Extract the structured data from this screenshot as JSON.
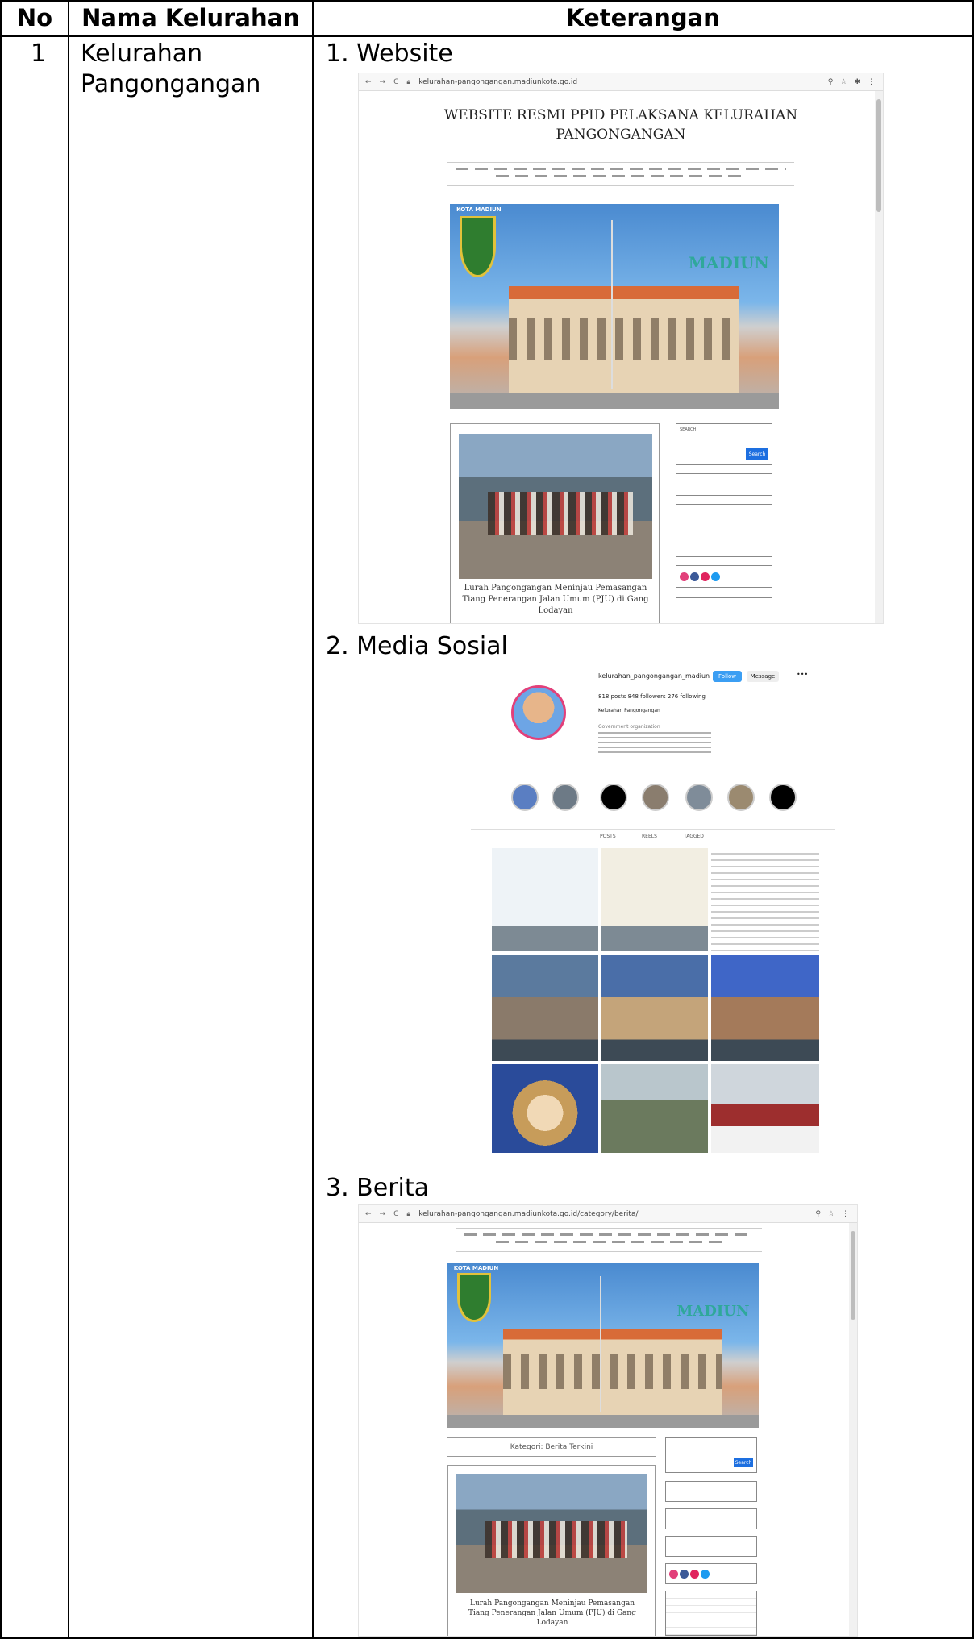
{
  "table": {
    "headers": [
      "No",
      "Nama Kelurahan",
      "Keterangan"
    ],
    "row": {
      "no": "1",
      "name_line1": "Kelurahan",
      "name_line2": "Pangongangan"
    }
  },
  "items": [
    {
      "label": "1. Website"
    },
    {
      "label": "2. Media Sosial"
    },
    {
      "label": "3. Berita"
    }
  ],
  "website_shot": {
    "url": "kelurahan-pangongangan.madiunkota.go.id",
    "title_line1": "WEBSITE RESMI PPID PELAKSANA KELURAHAN",
    "title_line2": "PANGONGANGAN",
    "hero_label": "KOTA MADIUN",
    "hero_logo": "MADIUN",
    "post_caption_line1": "Lurah Pangongangan Meninjau Pemasangan",
    "post_caption_line2": "Tiang Penerangan Jalan Umum (PJU) di Gang",
    "post_caption_line3": "Lodayan",
    "search_label": "SEARCH",
    "search_button": "Search"
  },
  "instagram_shot": {
    "username": "kelurahan_pangongangan_madiun",
    "follow_button": "Follow",
    "message_button": "Message",
    "stats": "818 posts   848 followers   276 following",
    "bio_name": "Kelurahan Pangongangan",
    "bio_category": "Government organization",
    "tabs": [
      "POSTS",
      "REELS",
      "TAGGED"
    ]
  },
  "berita_shot": {
    "url": "kelurahan-pangongangan.madiunkota.go.id/category/berita/",
    "hero_label": "KOTA MADIUN",
    "hero_logo": "MADIUN",
    "category_heading": "Kategori: Berita Terkini",
    "post_caption_line1": "Lurah Pangongangan Meninjau Pemasangan",
    "post_caption_line2": "Tiang Penerangan Jalan Umum (PJU) di Gang",
    "post_caption_line3": "Lodayan",
    "search_button": "Search"
  },
  "colors": {
    "instagram_accent": "#e2407a",
    "button_blue": "#1d6fe0"
  }
}
